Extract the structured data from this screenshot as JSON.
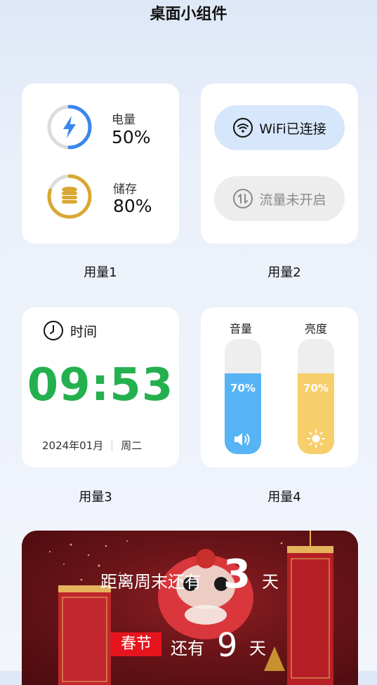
{
  "page": {
    "title": "桌面小组件"
  },
  "card1": {
    "caption": "用量1",
    "battery": {
      "label": "电量",
      "value": "50%",
      "percent": 50,
      "color": "#3a86f0",
      "icon": "lightning-icon"
    },
    "storage": {
      "label": "储存",
      "value": "80%",
      "percent": 80,
      "color": "#d9a832",
      "icon": "coins-stack-icon"
    }
  },
  "card2": {
    "caption": "用量2",
    "wifi": {
      "label": "WiFi已连接",
      "icon": "wifi-icon",
      "color": "#d6e6fb"
    },
    "data": {
      "label": "流量未开启",
      "icon": "data-transfer-icon",
      "color": "#ededed"
    }
  },
  "card3": {
    "caption": "用量3",
    "title": "时间",
    "time": "09:53",
    "date": "2024年01月",
    "weekday": "周二",
    "time_color": "#25b04f"
  },
  "card4": {
    "caption": "用量4",
    "volume": {
      "label": "音量",
      "value": "70%",
      "percent": 70,
      "color": "#56b4f5",
      "icon": "speaker-icon"
    },
    "brightness": {
      "label": "亮度",
      "value": "70%",
      "percent": 70,
      "color": "#f7cf6a",
      "icon": "sun-icon"
    }
  },
  "banner": {
    "weekend_prefix": "距离周末还有",
    "weekend_days": "3",
    "weekend_unit": "天",
    "festival": "春节",
    "festival_mid": "还有",
    "festival_days": "9",
    "festival_unit": "天",
    "badge_color": "#e8141d"
  }
}
